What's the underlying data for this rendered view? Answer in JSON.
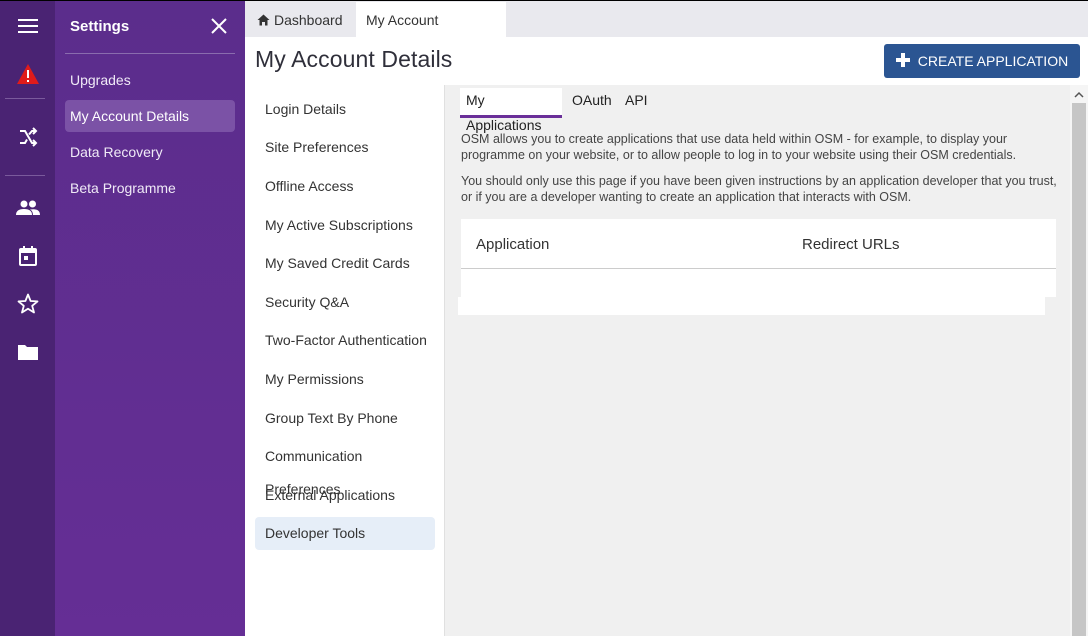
{
  "rail": {
    "icons": [
      "menu-icon",
      "warning-icon",
      "shuffle-icon",
      "people-icon",
      "calendar-icon",
      "star-icon",
      "folder-icon"
    ],
    "warning_color": "#e01b1b"
  },
  "settings": {
    "title": "Settings",
    "items": [
      {
        "label": "Upgrades"
      },
      {
        "label": "My Account Details"
      },
      {
        "label": "Data Recovery"
      },
      {
        "label": "Beta Programme"
      }
    ]
  },
  "tabs": [
    {
      "label": "Dashboard",
      "icon": "home-icon"
    },
    {
      "label": "My Account Details",
      "close": "×"
    }
  ],
  "page": {
    "title": "My Account Details",
    "create_button": "CREATE APPLICATION"
  },
  "submenu": {
    "items": [
      {
        "label": "Login Details"
      },
      {
        "label": "Site Preferences"
      },
      {
        "label": "Offline Access"
      },
      {
        "label": "My Active Subscriptions"
      },
      {
        "label": "My Saved Credit Cards"
      },
      {
        "label": "Security Q&A"
      },
      {
        "label": "Two-Factor Authentication"
      },
      {
        "label": "My Permissions"
      },
      {
        "label": "Group Text By Phone"
      },
      {
        "label": "Communication Preferences"
      },
      {
        "label": "External Applications"
      },
      {
        "label": "Developer Tools"
      }
    ]
  },
  "content": {
    "tabs": [
      {
        "label": "My Applications"
      },
      {
        "label": "OAuth"
      },
      {
        "label": "API"
      }
    ],
    "paragraph1": "OSM allows you to create applications that use data held within OSM - for example, to display your programme on your website, or to allow people to log in to your website using their OSM credentials.",
    "paragraph2": "You should only use this page if you have been given instructions by an application developer that you trust, or if you are a developer wanting to create an application that interacts with OSM.",
    "table": {
      "columns": [
        "Application",
        "Redirect URLs"
      ]
    }
  },
  "colors": {
    "rail": "#4a2373",
    "settings": "#5b2d8c",
    "accent_button": "#2b5592",
    "active_tab_underline": "#6a2f99"
  }
}
